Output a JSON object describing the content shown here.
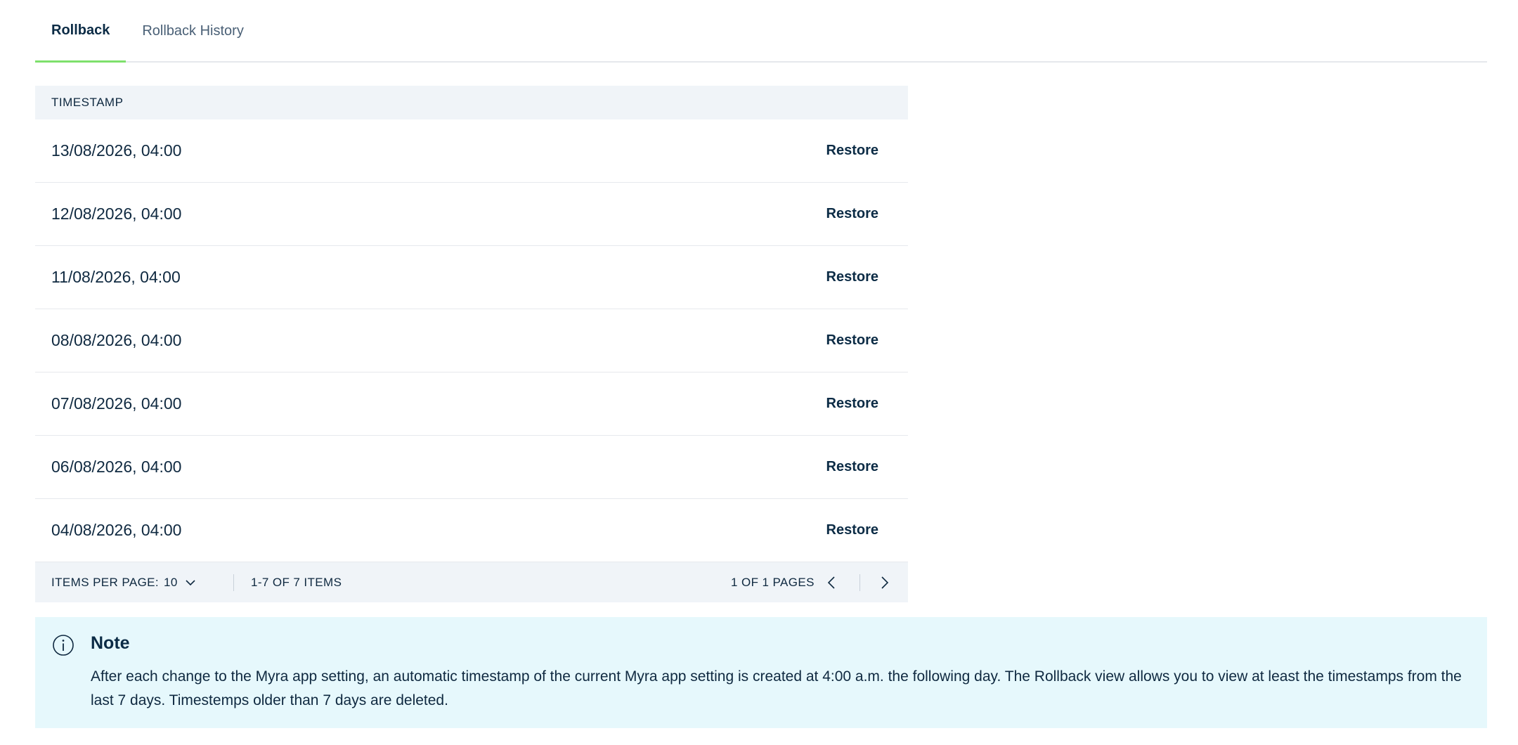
{
  "tabs": [
    {
      "label": "Rollback",
      "active": true
    },
    {
      "label": "Rollback History",
      "active": false
    }
  ],
  "table": {
    "header": "TIMESTAMP",
    "action_label": "Restore",
    "rows": [
      "13/08/2026, 04:00",
      "12/08/2026, 04:00",
      "11/08/2026, 04:00",
      "08/08/2026, 04:00",
      "07/08/2026, 04:00",
      "06/08/2026, 04:00",
      "04/08/2026, 04:00"
    ]
  },
  "pagination": {
    "items_per_page_label": "ITEMS PER PAGE:",
    "items_per_page_value": "10",
    "range_text": "1-7 OF 7 ITEMS",
    "page_text": "1  OF 1 PAGES"
  },
  "note": {
    "title": "Note",
    "text": "After each change to the Myra app setting, an automatic timestamp of the current Myra app setting is created at 4:00 a.m. the following day. The Rollback view allows you to view at least the timestamps from the last 7 days. Timestemps older than 7 days are deleted."
  },
  "colors": {
    "active_tab_underline": "#7ee06c",
    "table_header_bg": "#f0f4f8",
    "note_bg": "#e6f8fc",
    "text_primary": "#0f2940"
  },
  "icons": {
    "note": "info-icon",
    "dropdown": "chevron-down-icon",
    "prev": "chevron-left-icon",
    "next": "chevron-right-icon"
  }
}
